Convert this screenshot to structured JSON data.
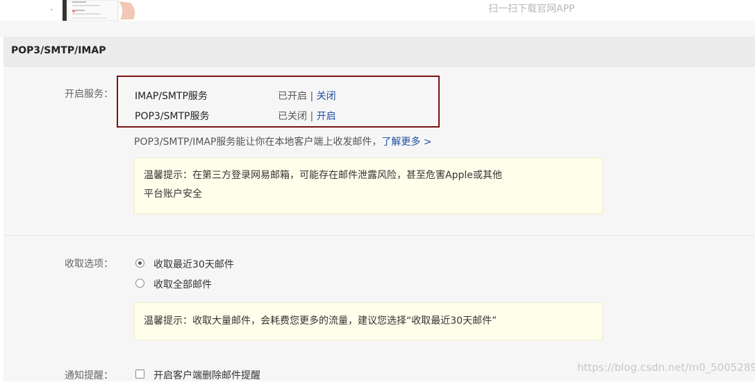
{
  "promo": {
    "scan_text": "扫一扫下载官网APP"
  },
  "panel": {
    "title": "POP3/SMTP/IMAP"
  },
  "services": {
    "label": "开启服务：",
    "items": [
      {
        "name": "IMAP/SMTP服务",
        "status": "已开启",
        "sep": " | ",
        "action": "关闭"
      },
      {
        "name": "POP3/SMTP服务",
        "status": "已关闭",
        "sep": " | ",
        "action": "开启"
      }
    ],
    "description": "POP3/SMTP/IMAP服务能让你在本地客户端上收发邮件，",
    "learn_more": "了解更多 >",
    "tip_line1": "温馨提示：在第三方登录网易邮箱，可能存在邮件泄露风险，甚至危害Apple或其他",
    "tip_line2": "平台账户安全"
  },
  "fetch": {
    "label": "收取选项：",
    "options": [
      {
        "label": "收取最近30天邮件",
        "checked": true
      },
      {
        "label": "收取全部邮件",
        "checked": false
      }
    ],
    "tip": "温馨提示：收取大量邮件，会耗费您更多的流量，建议您选择“收取最近30天邮件”"
  },
  "notify": {
    "label": "通知提醒：",
    "checkbox_label": "开启客户端删除邮件提醒",
    "checked": false
  },
  "watermark": "https://blog.csdn.net/m0_50052896",
  "colors": {
    "accent_border": "#7a1212",
    "link": "#1f4ea0",
    "tip_bg": "#fefeeb"
  }
}
